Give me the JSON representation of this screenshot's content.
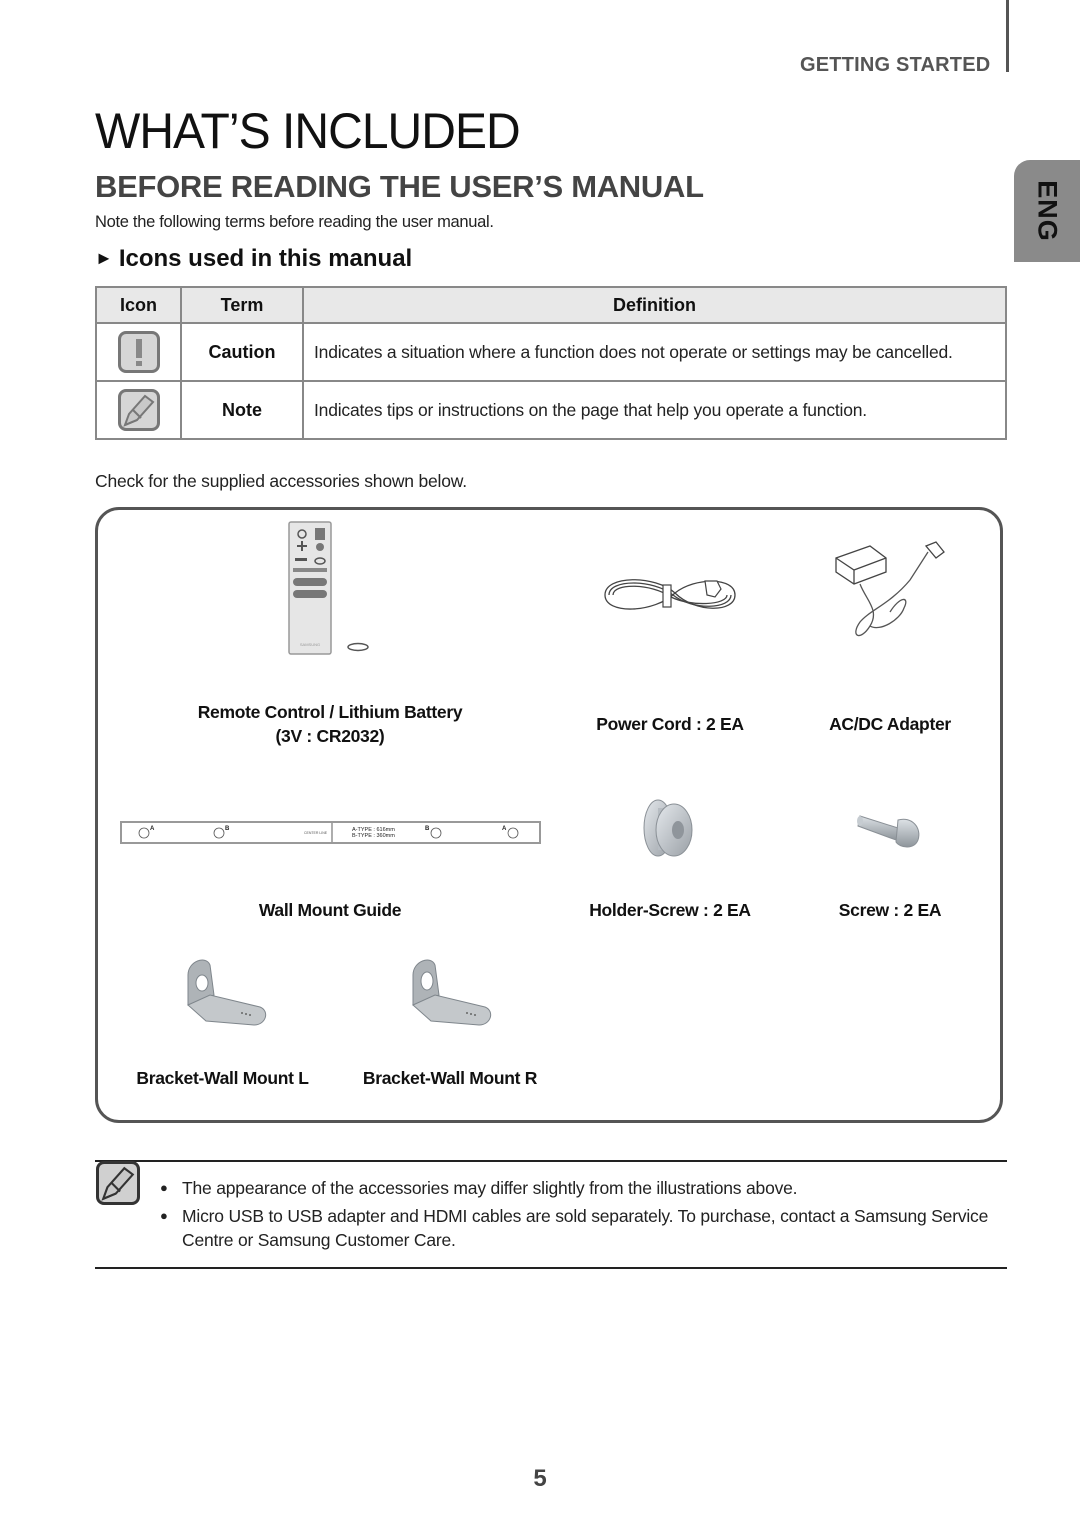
{
  "header": {
    "section_label": "GETTING STARTED",
    "language_tab": "ENG"
  },
  "page": {
    "title": "WHAT’S INCLUDED",
    "section_title": "BEFORE READING THE USER’S MANUAL",
    "intro": "Note the following terms before reading the user manual.",
    "subheading_arrow": "►",
    "subheading": "Icons used in this manual"
  },
  "icons_table": {
    "headers": [
      "Icon",
      "Term",
      "Definition"
    ],
    "rows": [
      {
        "icon": "caution-icon",
        "term": "Caution",
        "definition": "Indicates a situation where a function does not operate or settings may be cancelled."
      },
      {
        "icon": "note-icon",
        "term": "Note",
        "definition": "Indicates tips or instructions on the page that help you operate a function."
      }
    ]
  },
  "accessories": {
    "intro": "Check for the supplied accessories shown below.",
    "items": [
      {
        "icon": "remote-control-icon",
        "label": "Remote Control / Lithium Battery",
        "label2": "(3V : CR2032)"
      },
      {
        "icon": "power-cord-icon",
        "label": "Power Cord : 2 EA"
      },
      {
        "icon": "ac-dc-adapter-icon",
        "label": "AC/DC Adapter"
      },
      {
        "icon": "wall-mount-guide-icon",
        "label": "Wall Mount Guide"
      },
      {
        "icon": "holder-screw-icon",
        "label": "Holder-Screw : 2 EA"
      },
      {
        "icon": "screw-icon",
        "label": "Screw : 2 EA"
      },
      {
        "icon": "bracket-left-icon",
        "label": "Bracket-Wall Mount L"
      },
      {
        "icon": "bracket-right-icon",
        "label": "Bracket-Wall Mount R"
      }
    ],
    "wall_guide": {
      "mark_a": "A",
      "mark_b": "B",
      "center_line": "CENTER LINE",
      "a_type": "A-TYPE : 616mm",
      "b_type": "B-TYPE : 360mm"
    },
    "remote_brand": "SAMSUNG"
  },
  "notes": [
    "The appearance of the accessories may differ slightly from the illustrations above.",
    "Micro USB to USB adapter and HDMI cables are sold separately. To purchase, contact a Samsung Service Centre or Samsung Customer Care."
  ],
  "footer": {
    "page_number": "5"
  }
}
